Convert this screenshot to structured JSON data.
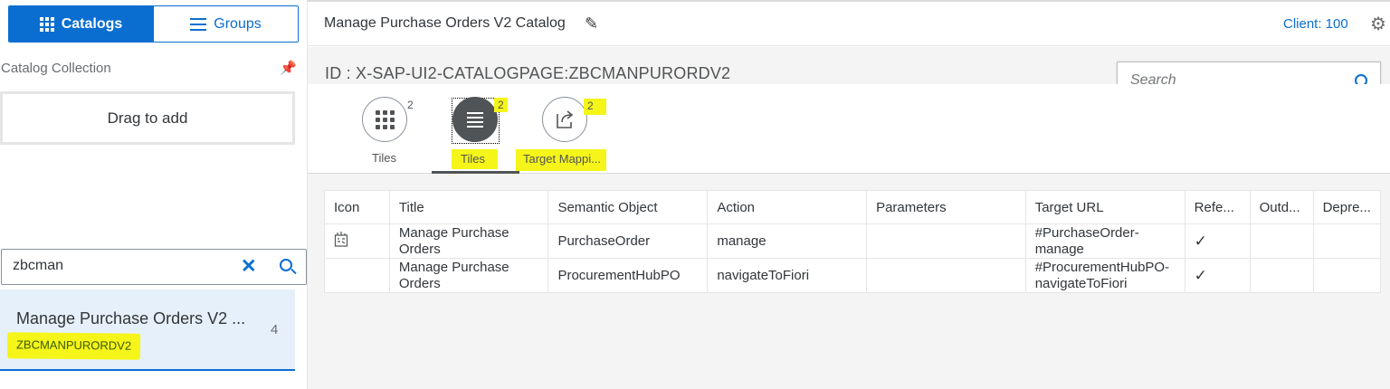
{
  "left": {
    "segments": {
      "catalogs_label": "Catalogs",
      "groups_label": "Groups"
    },
    "collection_label": "Catalog Collection",
    "drag_label": "Drag to add",
    "search": {
      "value": "zbcman"
    },
    "list_item": {
      "title": "Manage Purchase Orders V2 ...",
      "id": "ZBCMANPURORDV2",
      "count": "4"
    }
  },
  "header": {
    "title": "Manage Purchase Orders V2 Catalog",
    "client": "Client: 100"
  },
  "main": {
    "id_line": "ID : X-SAP-UI2-CATALOGPAGE:ZBCMANPURORDV2",
    "search_placeholder": "Search",
    "tabs": [
      {
        "label": "Tiles",
        "count": "2"
      },
      {
        "label": "Tiles",
        "count": "2"
      },
      {
        "label": "Target Mappi...",
        "count": "2"
      }
    ],
    "table": {
      "headers": [
        "Icon",
        "Title",
        "Semantic Object",
        "Action",
        "Parameters",
        "Target URL",
        "Refe...",
        "Outd...",
        "Depre..."
      ],
      "rows": [
        {
          "title_1": "Manage Purchase",
          "title_2": "Orders",
          "semantic_object": "PurchaseOrder",
          "action": "manage",
          "parameters": "",
          "url_1": "#PurchaseOrder-",
          "url_2": "manage",
          "ref": "✓"
        },
        {
          "title_1": "Manage Purchase",
          "title_2": "Orders",
          "semantic_object": "ProcurementHubPO",
          "action": "navigateToFiori",
          "parameters": "",
          "url_1": "#ProcurementHubPO-",
          "url_2": "navigateToFiori",
          "ref": "✓"
        }
      ]
    }
  },
  "colors": {
    "accent": "#0a6ed1",
    "highlight": "#f5f51a",
    "list_selected_bg": "#e5f0fa"
  },
  "icons": [
    "grid-icon",
    "list-icon",
    "pin-icon",
    "clear-icon",
    "search-icon",
    "pencil-icon",
    "gear-icon",
    "dots-grid-icon",
    "list-lines-icon",
    "share-icon",
    "check-icon",
    "app-icon"
  ]
}
